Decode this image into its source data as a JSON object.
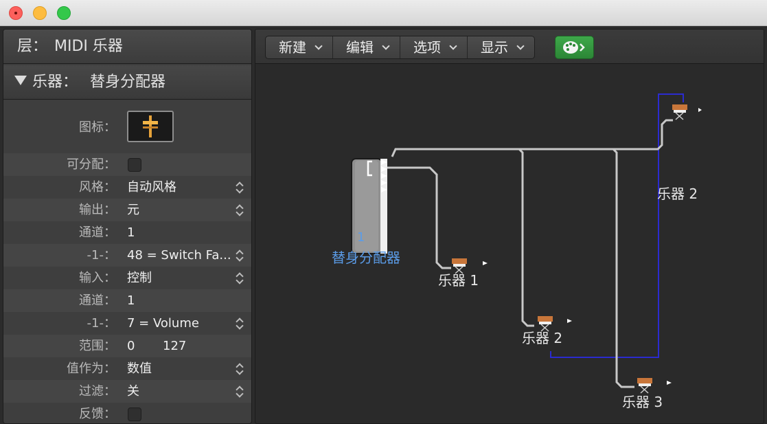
{
  "inspector": {
    "layer_label": "层：",
    "layer_value": "MIDI 乐器",
    "instrument_label": "乐器：",
    "instrument_value": "替身分配器",
    "props": {
      "icon": {
        "label": "图标："
      },
      "assignable": {
        "label": "可分配："
      },
      "style": {
        "label": "风格：",
        "value": "自动风格"
      },
      "output": {
        "label": "输出：",
        "value": "元"
      },
      "channel_out": {
        "label": "通道：",
        "value": "1"
      },
      "out_param": {
        "label": "-1-：",
        "value": "48 = Switch Fa..."
      },
      "input": {
        "label": "输入：",
        "value": "控制"
      },
      "channel_in": {
        "label": "通道：",
        "value": "1"
      },
      "in_param": {
        "label": "-1-：",
        "value": "7 = Volume"
      },
      "range": {
        "label": "范围：",
        "min": "0",
        "max": "127"
      },
      "value_as": {
        "label": "值作为：",
        "value": "数值"
      },
      "filter": {
        "label": "过滤：",
        "value": "关"
      },
      "feedback": {
        "label": "反馈："
      }
    }
  },
  "toolbar": {
    "new_label": "新建",
    "edit_label": "编辑",
    "options_label": "选项",
    "view_label": "显示",
    "midi_icon": "palette-arrow-icon"
  },
  "canvas": {
    "alias_object": {
      "label": "替身分配器",
      "number": "1"
    },
    "instrument_1": {
      "label": "乐器 1"
    },
    "instrument_2": {
      "label": "乐器 2"
    },
    "instrument_3": {
      "label": "乐器 3"
    },
    "instrument_2_alias": {
      "label": "乐器 2"
    },
    "colors": {
      "cable": "#c8c8c8",
      "alias_link": "#2b2bd0",
      "alias_text": "#5b9ce8"
    }
  }
}
